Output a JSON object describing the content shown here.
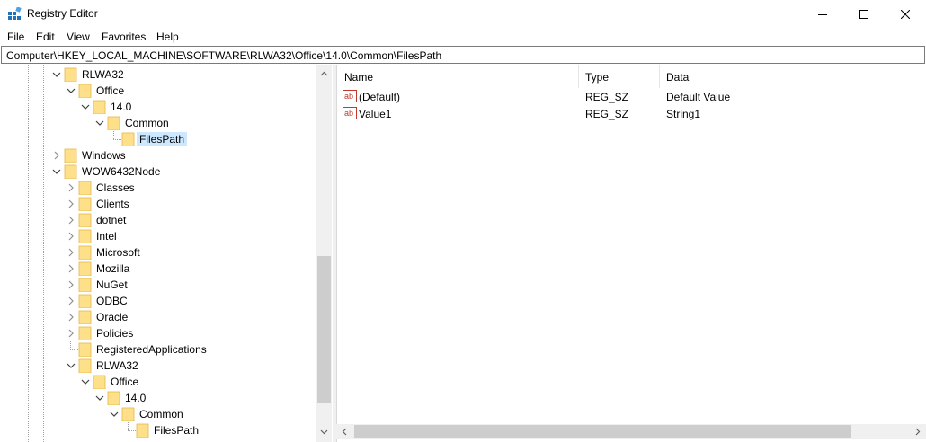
{
  "window": {
    "title": "Registry Editor"
  },
  "menu": [
    "File",
    "Edit",
    "View",
    "Favorites",
    "Help"
  ],
  "address": {
    "value": "Computer\\HKEY_LOCAL_MACHINE\\SOFTWARE\\RLWA32\\Office\\14.0\\Common\\FilesPath"
  },
  "tree": [
    {
      "label": "RLWA32",
      "depth": 0,
      "state": "expanded"
    },
    {
      "label": "Office",
      "depth": 1,
      "state": "expanded"
    },
    {
      "label": "14.0",
      "depth": 2,
      "state": "expanded"
    },
    {
      "label": "Common",
      "depth": 3,
      "state": "expanded"
    },
    {
      "label": "FilesPath",
      "depth": 4,
      "state": "leaf",
      "selected": true
    },
    {
      "label": "Windows",
      "depth": 0,
      "state": "collapsed"
    },
    {
      "label": "WOW6432Node",
      "depth": 0,
      "state": "expanded"
    },
    {
      "label": "Classes",
      "depth": 1,
      "state": "collapsed"
    },
    {
      "label": "Clients",
      "depth": 1,
      "state": "collapsed"
    },
    {
      "label": "dotnet",
      "depth": 1,
      "state": "collapsed"
    },
    {
      "label": "Intel",
      "depth": 1,
      "state": "collapsed"
    },
    {
      "label": "Microsoft",
      "depth": 1,
      "state": "collapsed"
    },
    {
      "label": "Mozilla",
      "depth": 1,
      "state": "collapsed"
    },
    {
      "label": "NuGet",
      "depth": 1,
      "state": "collapsed"
    },
    {
      "label": "ODBC",
      "depth": 1,
      "state": "collapsed"
    },
    {
      "label": "Oracle",
      "depth": 1,
      "state": "collapsed"
    },
    {
      "label": "Policies",
      "depth": 1,
      "state": "collapsed"
    },
    {
      "label": "RegisteredApplications",
      "depth": 1,
      "state": "leaf"
    },
    {
      "label": "RLWA32",
      "depth": 1,
      "state": "expanded"
    },
    {
      "label": "Office",
      "depth": 2,
      "state": "expanded"
    },
    {
      "label": "14.0",
      "depth": 3,
      "state": "expanded"
    },
    {
      "label": "Common",
      "depth": 4,
      "state": "expanded"
    },
    {
      "label": "FilesPath",
      "depth": 5,
      "state": "leaf"
    }
  ],
  "list": {
    "columns": [
      "Name",
      "Type",
      "Data"
    ],
    "rows": [
      {
        "name": "(Default)",
        "type": "REG_SZ",
        "data": "Default Value"
      },
      {
        "name": "Value1",
        "type": "REG_SZ",
        "data": "String1"
      }
    ]
  },
  "colors": {
    "selection": "#cce8ff",
    "folder": "#ffe08a",
    "folder_edge": "#e4b84a",
    "scrollbar_thumb": "#cdcdcd",
    "reg_icon": "#c0392b"
  }
}
